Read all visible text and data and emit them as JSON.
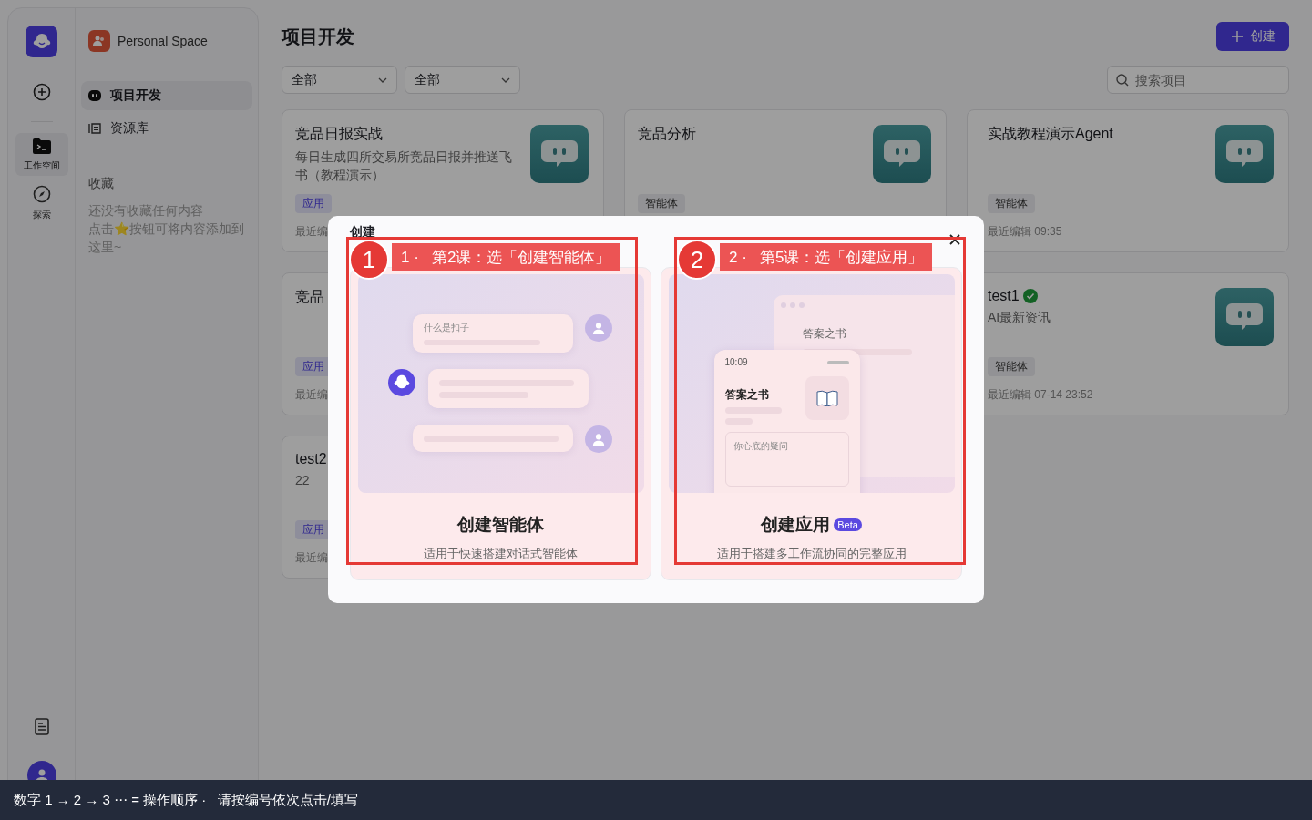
{
  "rail": {
    "items": [
      {
        "label": "工作空间",
        "kind": "workspace",
        "selected": true
      },
      {
        "label": "探索",
        "kind": "explore",
        "selected": false
      }
    ]
  },
  "space": {
    "name": "Personal Space"
  },
  "nav": [
    {
      "label": "项目开发",
      "kind": "project",
      "selected": true
    },
    {
      "label": "资源库",
      "kind": "library",
      "selected": false
    }
  ],
  "favorites": {
    "title": "收藏",
    "lines": [
      "还没有收藏任何内容",
      "点击⭐按钮可将内容添加到这里~"
    ]
  },
  "header": {
    "title": "项目开发",
    "create_button": "创建"
  },
  "filters": [
    "全部",
    "全部"
  ],
  "search": {
    "placeholder": "搜索项目"
  },
  "projects": [
    {
      "title": "竞品日报实战",
      "description": "每日生成四所交易所竞品日报并推送飞书（教程演示）",
      "tag": "应用",
      "kind": "app",
      "edited": "最近编",
      "icon": true,
      "verified": false
    },
    {
      "title": "竞品分析",
      "tag": "智能体",
      "kind": "agent",
      "icon": true,
      "verified": false
    },
    {
      "title": "实战教程演示Agent",
      "tag": "智能体",
      "kind": "agent",
      "edited": "最近编辑 09:35",
      "icon": true,
      "verified": false
    },
    {
      "title": "竞品",
      "tag": "应用",
      "kind": "app",
      "edited": "最近编",
      "icon": false,
      "verified": false
    },
    {
      "title": "test1",
      "description": "AI最新资讯",
      "tag": "智能体",
      "kind": "agent",
      "edited": "最近编辑 07-14 23:52",
      "icon": true,
      "verified": true
    },
    {
      "title": "test2",
      "description": "22",
      "tag": "应用",
      "kind": "app",
      "edited": "最近编",
      "icon": false,
      "verified": false
    }
  ],
  "modal": {
    "title": "创建",
    "options": [
      {
        "kind": "agent",
        "title": "创建智能体",
        "description": "适用于快速搭建对话式智能体",
        "preview": [
          "什么是扣子"
        ]
      },
      {
        "kind": "app",
        "title": "创建应用",
        "badge": "Beta",
        "description": "适用于搭建多工作流协同的完整应用",
        "preview": [
          "答案之书",
          "10:09",
          "答案之书",
          "你心底的疑问"
        ]
      }
    ]
  },
  "annotations": [
    {
      "number": "1",
      "label": "1 ·   第2课：选「创建智能体」"
    },
    {
      "number": "2",
      "label": "2 ·   第5课：选「创建应用」"
    }
  ],
  "hint_bar": {
    "text": "数字 1 → 2 → 3 ⋯ = 操作顺序 ·   请按编号依次点击/填写"
  }
}
